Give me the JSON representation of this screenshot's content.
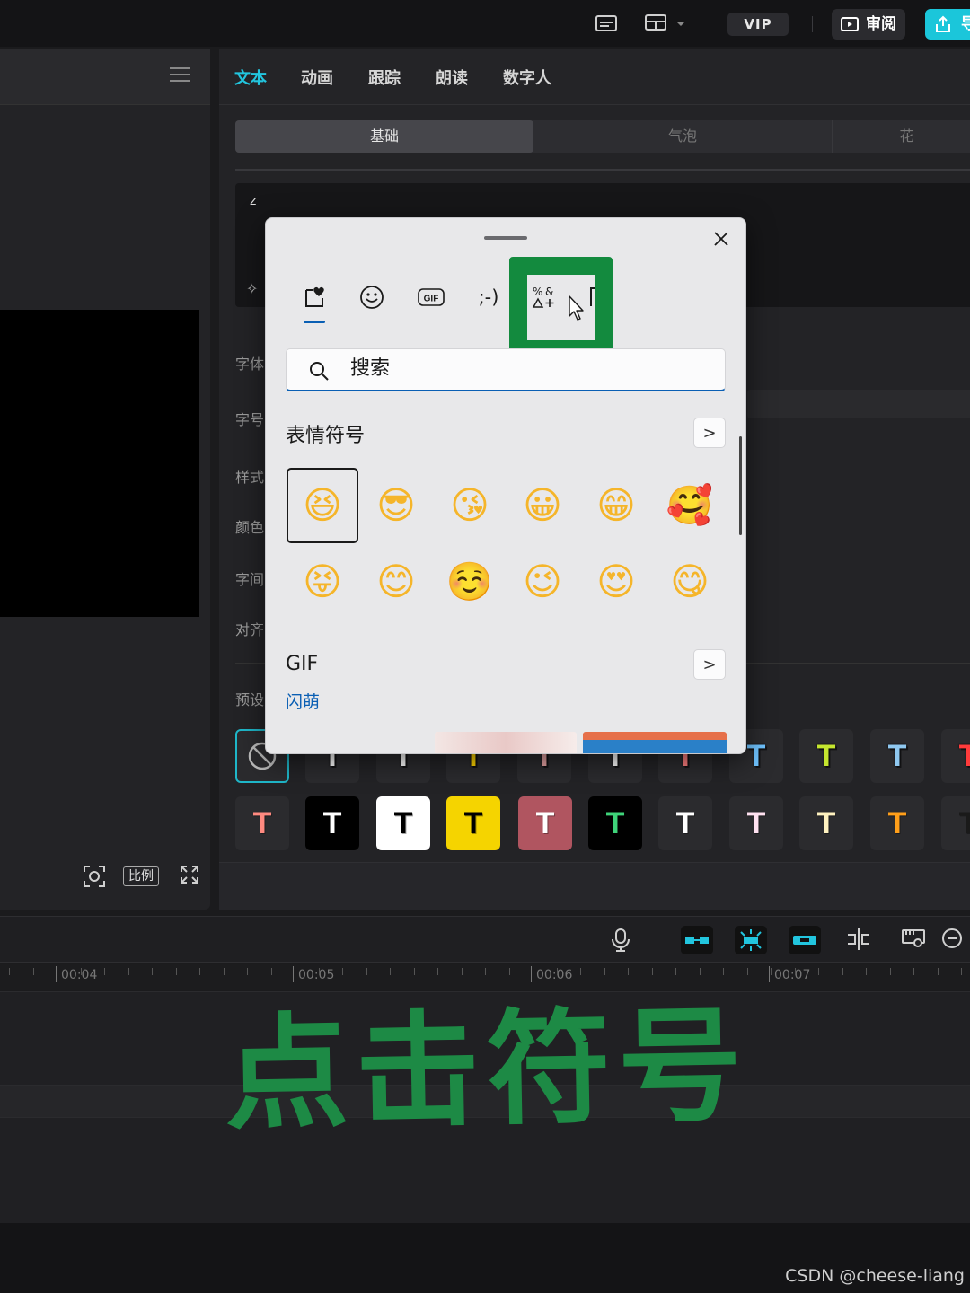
{
  "topbar": {
    "vip_label": "VIP",
    "review_label": "审阅",
    "export_label": "导"
  },
  "property_panel": {
    "tabs": [
      "文本",
      "动画",
      "跟踪",
      "朗读",
      "数字人"
    ],
    "active_tab": "文本",
    "subtabs": [
      "基础",
      "气泡",
      "花"
    ],
    "active_subtab": "基础",
    "text_value": "z",
    "labels": [
      "字体",
      "字号",
      "样式",
      "颜色",
      "字间",
      "对齐",
      "预设"
    ],
    "presets_row1_colors": [
      "#ffffff",
      "#ffffff",
      "#ffd400",
      "#e6a3a3",
      "#ffffff",
      "#ff7f7f",
      "#6fc3ff",
      "#c5e62f",
      "#8fc8f0",
      "#ff3b3b"
    ],
    "presets_row2": [
      {
        "bg": "#2b2b2e",
        "fg": "#ff8a80"
      },
      {
        "bg": "#000000",
        "fg": "#ffffff"
      },
      {
        "bg": "#ffffff",
        "fg": "#000000"
      },
      {
        "bg": "#f5d400",
        "fg": "#000000"
      },
      {
        "bg": "#b05560",
        "fg": "#ffffff"
      },
      {
        "bg": "#000000",
        "fg": "#3fd37a"
      },
      {
        "bg": "#2b2b2e",
        "fg": "#ffffff"
      },
      {
        "bg": "#2b2b2e",
        "fg": "#ffe1f0"
      },
      {
        "bg": "#2b2b2e",
        "fg": "#fff2c0"
      },
      {
        "bg": "#2b2b2e",
        "fg": "#ff9f1a"
      },
      {
        "bg": "#2b2b2e",
        "fg": "#1a1a1a"
      }
    ],
    "preset_glyph": "T"
  },
  "player": {
    "ratio_label": "比例"
  },
  "timeline": {
    "ruler_labels": [
      "00:04",
      "00:05",
      "00:06",
      "00:07"
    ]
  },
  "emoji_panel": {
    "categories": [
      "recent-heart",
      "emoji-face",
      "GIF",
      ";-)",
      "symbols",
      "more"
    ],
    "gif_icon_text": "GIF",
    "kaomoji_text": ";-)",
    "search_placeholder": "搜索",
    "section_emoji_title": "表情符号",
    "emoji_row1": [
      "😆",
      "😎",
      "😘",
      "😀",
      "😁",
      "🥰"
    ],
    "emoji_row2": [
      "😝",
      "😊",
      "☺️",
      "😉",
      "😍",
      "😋"
    ],
    "section_gif_title": "GIF",
    "gif_subtitle": "闪萌",
    "chevron": ">"
  },
  "annotation": {
    "text": "点击符号",
    "color": "#1d8a45"
  },
  "watermark": "CSDN @cheese-liang",
  "colors": {
    "accent": "#22c5de",
    "highlight_green": "#138a3e",
    "windows_blue": "#0a5fb4"
  }
}
